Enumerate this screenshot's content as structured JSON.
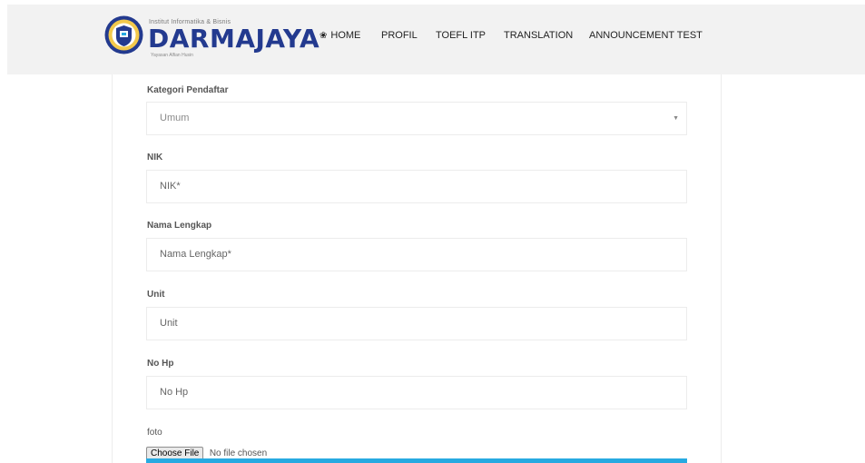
{
  "header": {
    "logo": {
      "small_text": "Institut Informatika & Bisnis",
      "name": "DARMAJAYA",
      "tagline": "Yayasan Alfian Husin"
    },
    "nav": {
      "home": "HOME",
      "profil": "PROFIL",
      "toefl": "TOEFL ITP",
      "translation": "TRANSLATION",
      "announcement": "ANNOUNCEMENT TEST"
    }
  },
  "form": {
    "kategori": {
      "label": "Kategori Pendaftar",
      "selected": "Umum"
    },
    "nik": {
      "label": "NIK",
      "placeholder": "NIK*"
    },
    "nama": {
      "label": "Nama Lengkap",
      "placeholder": "Nama Lengkap*"
    },
    "unit": {
      "label": "Unit",
      "placeholder": "Unit"
    },
    "nohp": {
      "label": "No Hp",
      "placeholder": "No Hp"
    },
    "foto": {
      "label": "foto",
      "button": "Choose File",
      "status": "No file chosen"
    }
  },
  "colors": {
    "brand_blue": "#233a8f",
    "header_bg": "#f2f2f2",
    "accent_cyan": "#27aae1"
  }
}
